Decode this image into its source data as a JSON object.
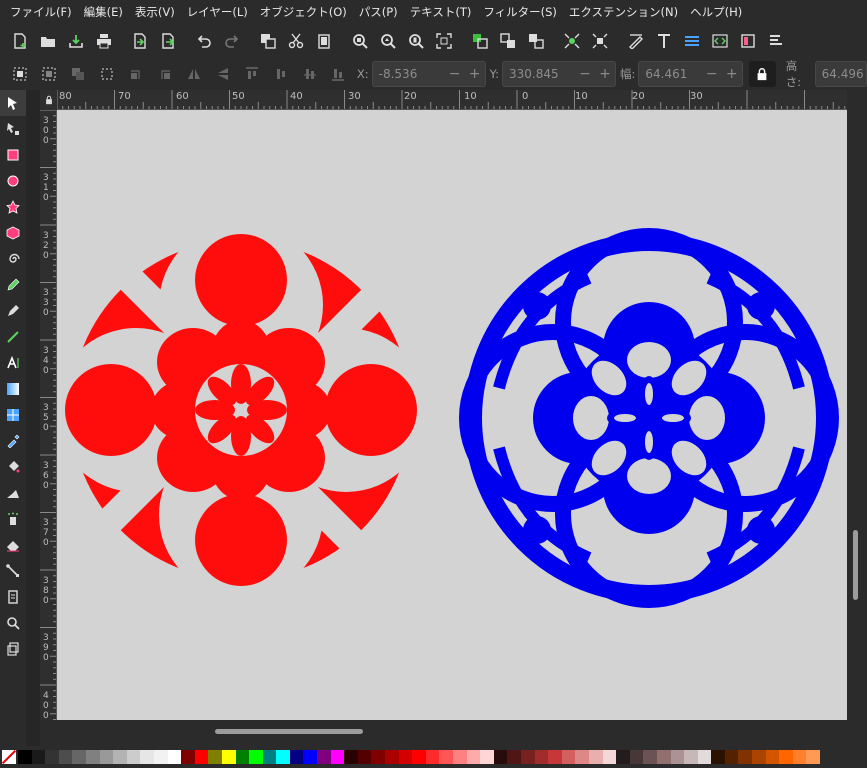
{
  "menu": {
    "items": [
      "ファイル(F)",
      "編集(E)",
      "表示(V)",
      "レイヤー(L)",
      "オブジェクト(O)",
      "パス(P)",
      "テキスト(T)",
      "フィルター(S)",
      "エクステンション(N)",
      "ヘルプ(H)"
    ]
  },
  "commands": [
    "new-document",
    "open-file",
    "import",
    "print",
    "import-bitmap",
    "export",
    "undo",
    "redo",
    "duplicate",
    "cut",
    "paste",
    "zoom-selection",
    "zoom-drawing",
    "zoom-page",
    "zoom-fit",
    "group",
    "ungroup",
    "clone",
    "node-snap",
    "bbox-snap",
    "fill-stroke",
    "text-font",
    "layers",
    "xml-editor",
    "objects",
    "align-distribute"
  ],
  "tool_controls": {
    "x_label": "X:",
    "x_value": "-8.536",
    "y_label": "Y:",
    "y_value": "330.845",
    "w_label": "幅:",
    "w_value": "64.461",
    "h_label": "高さ:",
    "h_value": "64.496"
  },
  "ruler_top": [
    "80",
    "70",
    "60",
    "50",
    "40",
    "30",
    "20",
    "10",
    "0",
    "10",
    "20",
    "30"
  ],
  "ruler_left": [
    "3\n0\n0",
    "3\n1\n0",
    "3\n2\n0",
    "3\n3\n0",
    "3\n4\n0",
    "3\n5\n0",
    "3\n6\n0",
    "3\n7\n0",
    "3\n8\n0",
    "3\n9\n0",
    "4\n0\n0"
  ],
  "colors": {
    "canvas": "#d3d3d3",
    "red_emblem": "#ff0d0d",
    "blue_emblem": "#0000ee",
    "accent": "#2b2b2b"
  },
  "palette": [
    "#000000",
    "#1a1a1a",
    "#333333",
    "#4d4d4d",
    "#666666",
    "#808080",
    "#999999",
    "#b3b3b3",
    "#cccccc",
    "#e6e6e6",
    "#f2f2f2",
    "#ffffff",
    "#800000",
    "#ff0000",
    "#808000",
    "#ffff00",
    "#008000",
    "#00ff00",
    "#008080",
    "#00ffff",
    "#000080",
    "#0000ff",
    "#800080",
    "#ff00ff",
    "#2b0000",
    "#550000",
    "#800000",
    "#aa0000",
    "#d40000",
    "#ff0000",
    "#ff2a2a",
    "#ff5555",
    "#ff8080",
    "#ffaaaa",
    "#ffd5d5",
    "#280b0b",
    "#501616",
    "#782121",
    "#a02c2c",
    "#c83737",
    "#d35f5f",
    "#de8787",
    "#e9afaf",
    "#f4d7d7",
    "#241c1c",
    "#483737",
    "#6c5353",
    "#916f6f",
    "#ac9393",
    "#c8b7b7",
    "#e3dbdb",
    "#2b1100",
    "#552200",
    "#803300",
    "#aa4400",
    "#d45500",
    "#ff6600",
    "#ff7f2a",
    "#ff9955"
  ]
}
